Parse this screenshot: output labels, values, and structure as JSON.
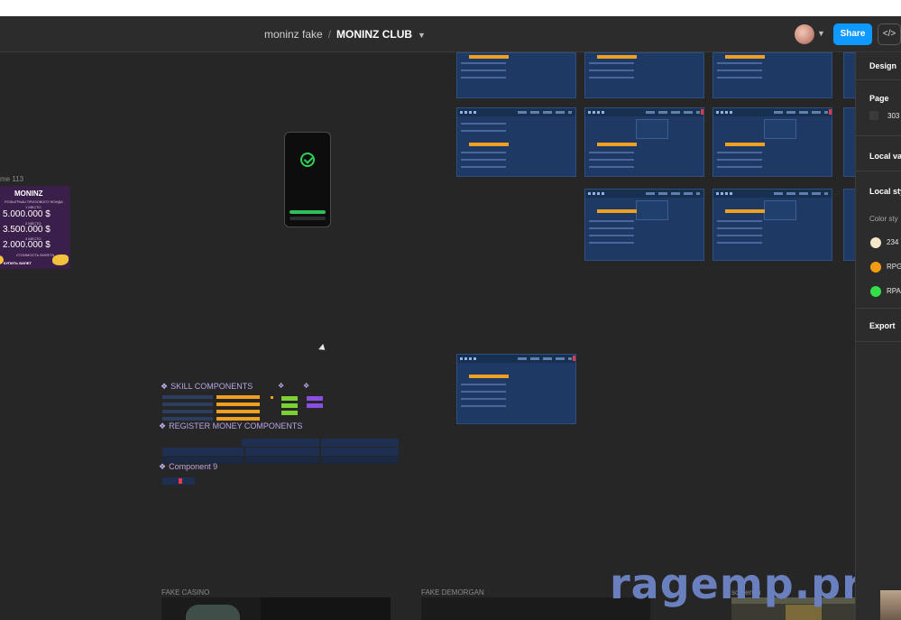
{
  "toolbar": {
    "project": "moninz fake",
    "separator": "/",
    "file": "MONINZ CLUB",
    "share_label": "Share",
    "dev_label": "</>"
  },
  "canvas": {
    "frame_label": "me 113",
    "promo": {
      "title": "MONINZ",
      "line1": "РОЗЫГРЫШ ПРИЗОВОГО ФОНДА",
      "cap1": "1 МЕСТО",
      "amount1": "5.000.000 $",
      "cap2": "2 МЕСТО",
      "amount2": "3.500.000 $",
      "cap3": "3 МЕСТО",
      "amount3": "2.000.000 $",
      "cap4": "СТОИМОСТЬ БИЛЕТА",
      "button": "КУПИТЬ БИЛЕТ"
    },
    "components": {
      "skill": "SKILL COMPONENTS",
      "register": "REGISTER MONEY COMPONENTS",
      "component9": "Component 9"
    },
    "sections": {
      "fake_casino": "FAKE CASINO",
      "fake_demorgan": "FAKE DEMORGAN",
      "screenshot": "screensh"
    },
    "watermark": "ragemp.pro"
  },
  "right_panel": {
    "design_tab": "Design",
    "page_heading": "Page",
    "page_value": "303",
    "local_variables": "Local va",
    "local_styles": "Local sty",
    "color_styles": "Color sty",
    "colors": [
      {
        "label": "234",
        "color": "#f6e7c8"
      },
      {
        "label": "RPG",
        "color": "#f39c12"
      },
      {
        "label": "RPA",
        "color": "#33e04a"
      }
    ],
    "export": "Export"
  },
  "colors": {
    "accent": "#0d99ff",
    "canvas": "#262626",
    "panel": "#2c2c2c"
  }
}
